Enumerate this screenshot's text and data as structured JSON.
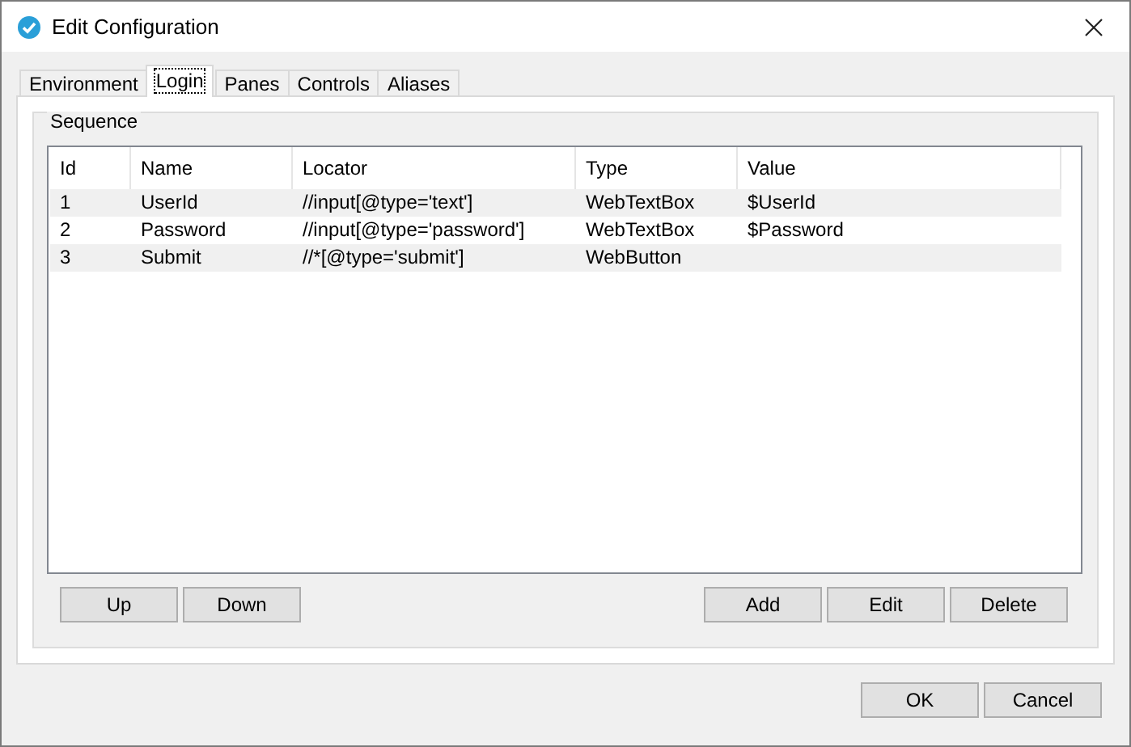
{
  "window": {
    "title": "Edit Configuration"
  },
  "tabs": [
    {
      "label": "Environment",
      "selected": false
    },
    {
      "label": "Login",
      "selected": true
    },
    {
      "label": "Panes",
      "selected": false
    },
    {
      "label": "Controls",
      "selected": false
    },
    {
      "label": "Aliases",
      "selected": false
    }
  ],
  "group": {
    "title": "Sequence"
  },
  "table": {
    "columns": [
      "Id",
      "Name",
      "Locator",
      "Type",
      "Value"
    ],
    "rows": [
      [
        "1",
        "UserId",
        "//input[@type='text']",
        "WebTextBox",
        "$UserId"
      ],
      [
        "2",
        "Password",
        "//input[@type='password']",
        "WebTextBox",
        "$Password"
      ],
      [
        "3",
        "Submit",
        "//*[@type='submit']",
        "WebButton",
        ""
      ]
    ]
  },
  "left_buttons": [
    "Up",
    "Down"
  ],
  "right_buttons": [
    "Add",
    "Edit",
    "Delete"
  ],
  "dialog_buttons": [
    "OK",
    "Cancel"
  ]
}
